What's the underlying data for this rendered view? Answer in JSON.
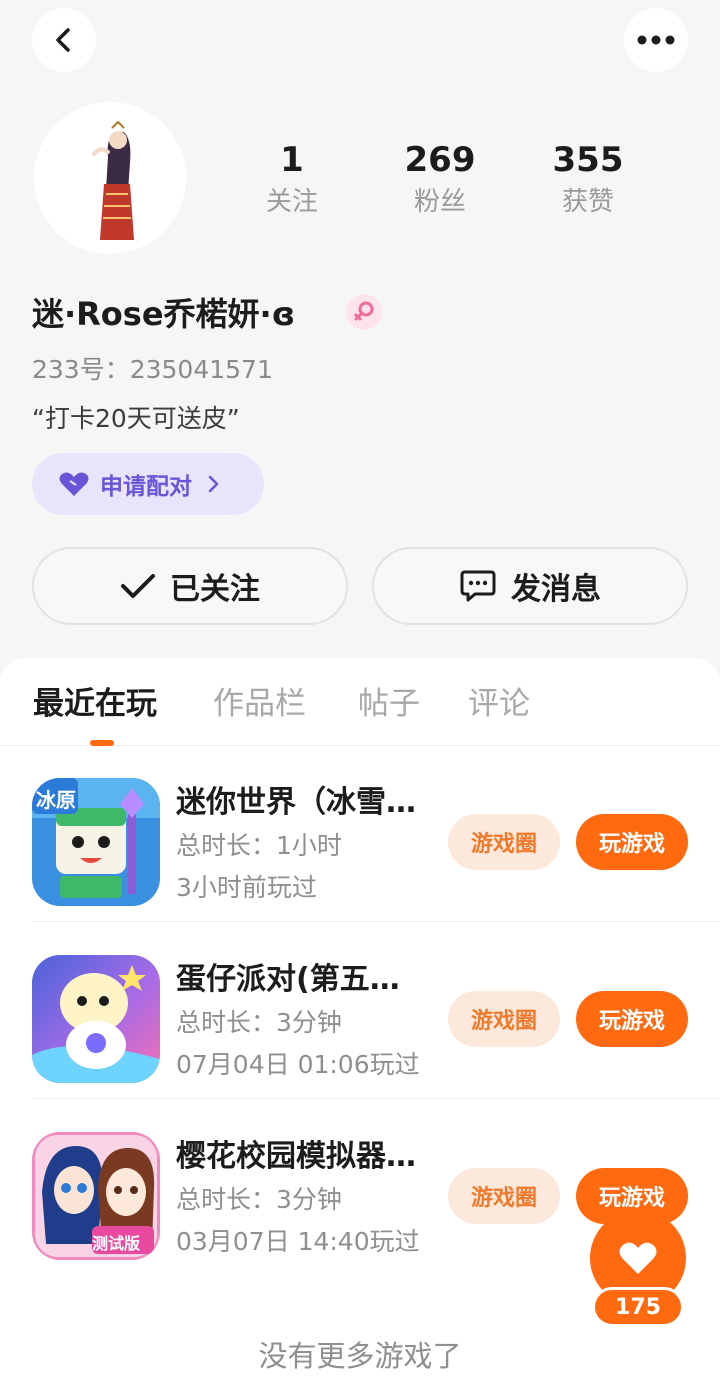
{
  "profile": {
    "stats": [
      {
        "value": "1",
        "label": "关注"
      },
      {
        "value": "269",
        "label": "粉丝"
      },
      {
        "value": "355",
        "label": "获赞"
      }
    ],
    "name": "迷·Rose乔楉妍·ɞ",
    "uid": "233号：235041571",
    "bio": "“打卡20天可送皮”",
    "pair_label": "申请配对",
    "follow_label": "已关注",
    "message_label": "发消息"
  },
  "tabs": [
    {
      "label": "最近在玩",
      "active": true
    },
    {
      "label": "作品栏",
      "active": false
    },
    {
      "label": "帖子",
      "active": false
    },
    {
      "label": "评论",
      "active": false
    }
  ],
  "games": [
    {
      "title": "迷你世界（冰雪…",
      "duration": "总时长：1小时",
      "last_played": "3小时前玩过",
      "circle_label": "游戏圈",
      "play_label": "玩游戏",
      "icon": "mini-world-icon"
    },
    {
      "title": "蛋仔派对(第五…",
      "duration": "总时长：3分钟",
      "last_played": "07月04日 01:06玩过",
      "circle_label": "游戏圈",
      "play_label": "玩游戏",
      "icon": "eggy-party-icon"
    },
    {
      "title": "樱花校园模拟器…",
      "duration": "总时长：3分钟",
      "last_played": "03月07日 14:40玩过",
      "circle_label": "游戏圈",
      "play_label": "玩游戏",
      "icon": "sakura-school-icon"
    }
  ],
  "icon_badges": {
    "game1": "冰原",
    "game3": "测试版"
  },
  "footer": "没有更多游戏了",
  "like": {
    "count": "175"
  },
  "colors": {
    "accent": "#ff6a10",
    "pair": "#6a55d6",
    "background": "#f6f6f6"
  }
}
